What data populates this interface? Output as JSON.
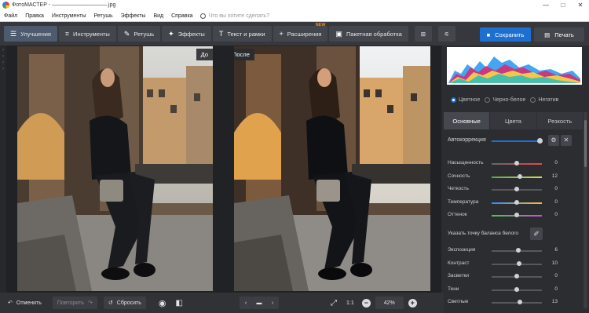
{
  "window": {
    "app_name": "ФотоМАСТЕР",
    "file_name": "——————————.jpg",
    "title_sep": " - ",
    "buttons": [
      "—",
      "□",
      "✕"
    ]
  },
  "menu": {
    "items": [
      "Файл",
      "Правка",
      "Инструменты",
      "Ретушь",
      "Эффекты",
      "Вид",
      "Справка"
    ],
    "search_placeholder": "Что вы хотите сделать?"
  },
  "toolbar": {
    "tabs": [
      {
        "label": "Улучшения",
        "icon": "sliders-icon",
        "glyph": "☰",
        "active": true
      },
      {
        "label": "Инструменты",
        "icon": "crop-icon",
        "glyph": "⌗",
        "active": false
      },
      {
        "label": "Ретушь",
        "icon": "brush-icon",
        "glyph": "✎",
        "active": false
      },
      {
        "label": "Эффекты",
        "icon": "sparkle-icon",
        "glyph": "✦",
        "active": false
      },
      {
        "label": "Текст и рамки",
        "icon": "text-icon",
        "glyph": "T",
        "active": false
      },
      {
        "label": "Расширения",
        "icon": "plus-icon",
        "glyph": "+",
        "active": false,
        "badge": "NEW"
      },
      {
        "label": "Пакетная обработка",
        "icon": "images-icon",
        "glyph": "▣",
        "active": false
      }
    ],
    "extra_icons": [
      "add-layer-icon",
      "layers-settings-icon"
    ],
    "save_label": "Сохранить",
    "print_label": "Печать"
  },
  "canvas": {
    "before_label": "До",
    "after_label": "После"
  },
  "bottom": {
    "undo": "Отменить",
    "redo": "Повторить",
    "reset": "Сбросить",
    "zoom_one": "1:1",
    "zoom_level": "42%"
  },
  "panel": {
    "modes": [
      "Цветное",
      "Черно-белое",
      "Негатив"
    ],
    "tabs": [
      "Основные",
      "Цвета",
      "Резкость"
    ],
    "auto_label": "Автокоррекция",
    "white_balance_label": "Указать точку баланса белого",
    "sliders_a": [
      {
        "label": "Насыщенность",
        "value": "0",
        "pos": 0.5
      },
      {
        "label": "Сочность",
        "value": "12",
        "pos": 0.56
      },
      {
        "label": "Четкость",
        "value": "0",
        "pos": 0.5
      },
      {
        "label": "Температура",
        "value": "0",
        "pos": 0.5
      },
      {
        "label": "Оттенок",
        "value": "0",
        "pos": 0.5
      }
    ],
    "sliders_b": [
      {
        "label": "Экспозиция",
        "value": "6",
        "pos": 0.53
      },
      {
        "label": "Контраст",
        "value": "10",
        "pos": 0.55
      },
      {
        "label": "Засветки",
        "value": "0",
        "pos": 0.5
      },
      {
        "label": "Тени",
        "value": "0",
        "pos": 0.5
      },
      {
        "label": "Светлые",
        "value": "13",
        "pos": 0.56
      }
    ]
  },
  "colors": {
    "accent": "#1e6fd2",
    "badge": "#ff8a1c"
  }
}
